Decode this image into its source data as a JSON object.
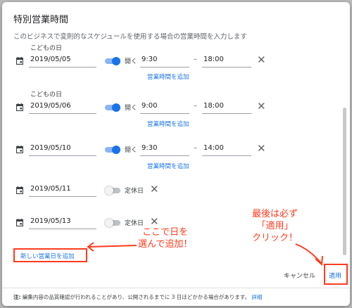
{
  "dialog": {
    "title": "特別営業時間",
    "subtitle": "このビジネスで変則的なスケジュールを使用する場合の営業時間を入力します"
  },
  "rows": [
    {
      "holiday": "こどもの日",
      "date": "2019/05/05",
      "status": "開く",
      "open": "9:30",
      "close": "18:00",
      "toggle": "on"
    },
    {
      "holiday": "こどもの日",
      "date": "2019/05/06",
      "status": "開く",
      "open": "9:00",
      "close": "18:00",
      "toggle": "on"
    },
    {
      "holiday": "",
      "date": "2019/05/10",
      "status": "開く",
      "open": "9:30",
      "close": "14:00",
      "toggle": "on"
    },
    {
      "holiday": "",
      "date": "2019/05/11",
      "status": "定休日",
      "toggle": "off"
    },
    {
      "holiday": "",
      "date": "2019/05/13",
      "status": "定休日",
      "toggle": "off"
    }
  ],
  "add_hours_label": "営業時間を追加",
  "time_separator": "–",
  "new_date_label": "新しい営業日を追加",
  "cancel_label": "キャンセル",
  "apply_label": "適用",
  "footer": {
    "note_label": "注:",
    "note_text": "編集内容の品質確認が行われることがあり、公開されるまでに 3 日ほどかかる場合があります。",
    "details_link": "詳細"
  },
  "annotations": {
    "left_line1": "ここで日を",
    "left_line2": "選んで追加！",
    "right_line1": "最後は必ず",
    "right_line2": "「適用」",
    "right_line3": "クリック！"
  },
  "colors": {
    "accent": "#1a73e8",
    "annotation": "#ff3b1f",
    "toggle_on_track": "#8ab4f8"
  }
}
